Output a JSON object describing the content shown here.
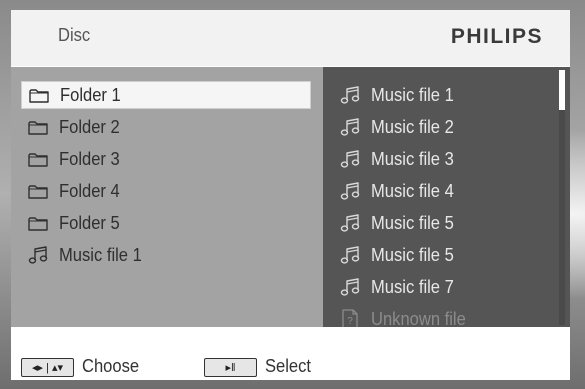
{
  "header": {
    "title": "Disc",
    "brand": "PHILIPS"
  },
  "left_list": [
    {
      "label": "Folder 1",
      "icon": "folder-icon",
      "selected": true
    },
    {
      "label": "Folder 2",
      "icon": "folder-icon"
    },
    {
      "label": "Folder 3",
      "icon": "folder-icon"
    },
    {
      "label": "Folder 4",
      "icon": "folder-icon"
    },
    {
      "label": "Folder 5",
      "icon": "folder-icon"
    },
    {
      "label": "Music file 1",
      "icon": "music-note-icon"
    }
  ],
  "right_list": [
    {
      "label": "Music file 1",
      "icon": "music-note-icon"
    },
    {
      "label": "Music file 2",
      "icon": "music-note-icon"
    },
    {
      "label": "Music file 3",
      "icon": "music-note-icon"
    },
    {
      "label": "Music file 4",
      "icon": "music-note-icon"
    },
    {
      "label": "Music file 5",
      "icon": "music-note-icon"
    },
    {
      "label": "Music file 5",
      "icon": "music-note-icon"
    },
    {
      "label": "Music file 7",
      "icon": "music-note-icon"
    },
    {
      "label": "Unknown file",
      "icon": "unknown-file-icon",
      "disabled": true
    }
  ],
  "footer": {
    "choose_key": "◂▸ | ▴▾",
    "choose_label": "Choose",
    "select_key": "▸‖",
    "select_label": "Select"
  },
  "colors": {
    "left_pane": "#a3a3a3",
    "right_pane": "#555555",
    "highlight": "#f5f5f5",
    "disabled_text": "#8c8c8c"
  }
}
